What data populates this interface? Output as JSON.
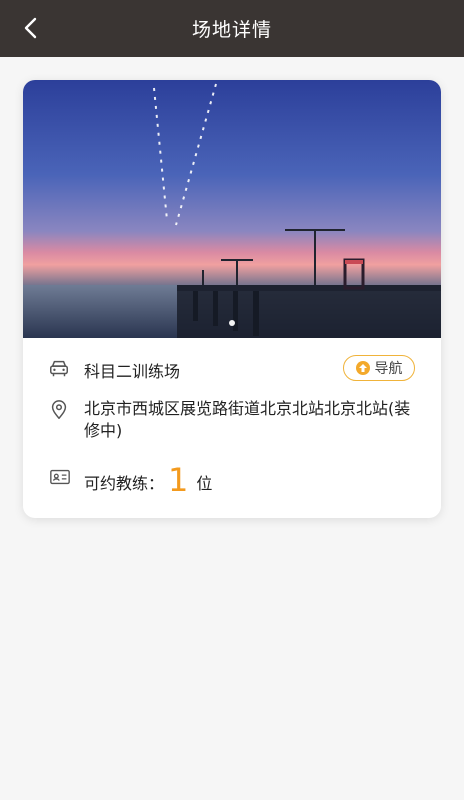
{
  "header": {
    "title": "场地详情"
  },
  "venue": {
    "name": "科目二训练场",
    "nav_label": "导航",
    "address": "北京市西城区展览路街道北京北站北京北站(装修中)",
    "coach_label": "可约教练：",
    "coach_count": "1",
    "coach_unit": "位"
  },
  "colors": {
    "header_bg": "#3a3533",
    "accent": "#f39a1e"
  }
}
